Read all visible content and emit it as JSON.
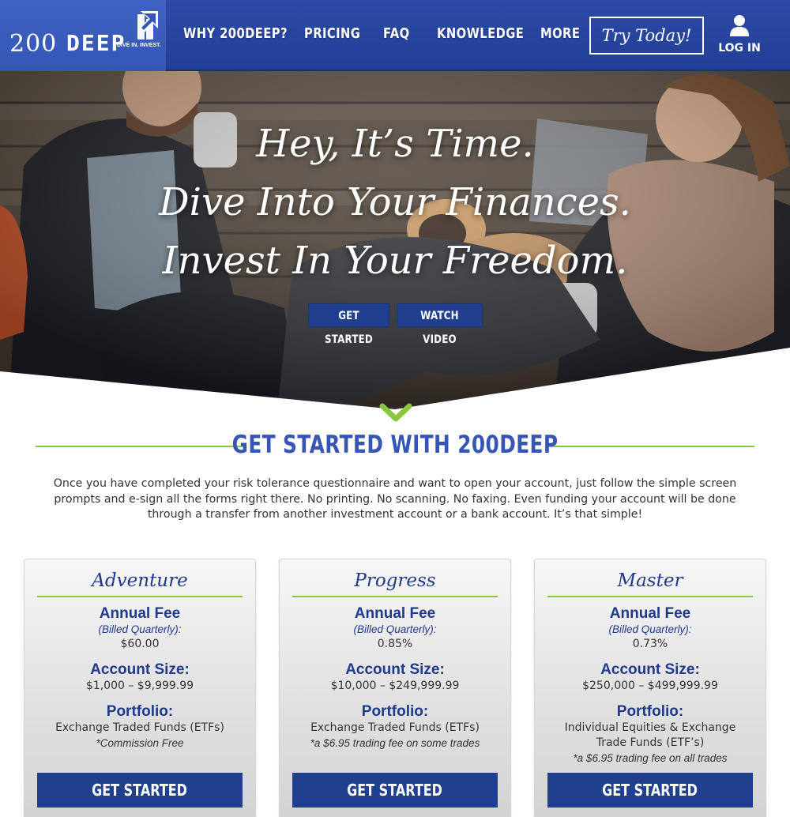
{
  "header": {
    "logo": {
      "number": "200",
      "word": "DEEP",
      "tagline": "DIVE IN. INVEST."
    },
    "nav": [
      {
        "label": "WHY 200DEEP?"
      },
      {
        "label": "PRICING"
      },
      {
        "label": "FAQ"
      },
      {
        "label": "KNOWLEDGE"
      },
      {
        "label": "MORE"
      }
    ],
    "cta_label": "Try Today!",
    "login_label": "LOG IN",
    "colors": {
      "bar": "#223f97",
      "logo_bg": "#3556b5"
    }
  },
  "hero": {
    "lines": [
      "Hey, It’s Time.",
      "Dive Into Your Finances.",
      "Invest In Your Freedom."
    ],
    "buttons": {
      "get_started": "GET STARTED",
      "watch_video": "WATCH VIDEO"
    }
  },
  "section": {
    "title": "GET STARTED WITH 200DEEP",
    "intro": "Once you have completed your risk tolerance questionnaire and want to open your account, just follow the simple screen prompts and e-sign all the forms right there. No printing. No scanning. No faxing. Even funding your account will be done through a transfer from another investment account or a bank account. It’s that simple!",
    "accent_color": "#8cc63f",
    "title_color": "#3556b5"
  },
  "plans": [
    {
      "name": "Adventure",
      "fee_heading": "Annual Fee",
      "fee_note": "(Billed Quarterly):",
      "fee_value": "$60.00",
      "size_heading": "Account Size:",
      "size_value": "$1,000 – $9,999.99",
      "portfolio_heading": "Portfolio:",
      "portfolio_value": "Exchange Traded Funds (ETFs)",
      "portfolio_note": "*Commission Free",
      "button": "GET STARTED"
    },
    {
      "name": "Progress",
      "fee_heading": "Annual Fee",
      "fee_note": "(Billed Quarterly):",
      "fee_value": "0.85%",
      "size_heading": "Account Size:",
      "size_value": "$10,000 – $249,999.99",
      "portfolio_heading": "Portfolio:",
      "portfolio_value": "Exchange Traded Funds (ETFs)",
      "portfolio_note": "*a $6.95 trading fee on some trades",
      "button": "GET STARTED"
    },
    {
      "name": "Master",
      "fee_heading": "Annual Fee",
      "fee_note": "(Billed Quarterly):",
      "fee_value": "0.73%",
      "size_heading": "Account Size:",
      "size_value": "$250,000 – $499,999.99",
      "portfolio_heading": "Portfolio:",
      "portfolio_value": "Individual Equities & Exchange Trade Funds (ETF’s)",
      "portfolio_note": "*a $6.95 trading fee on all trades",
      "button": "GET STARTED"
    }
  ]
}
